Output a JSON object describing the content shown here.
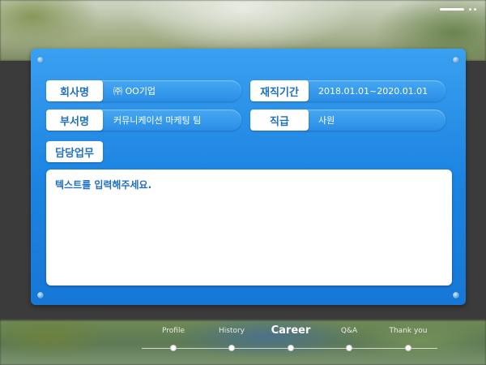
{
  "form": {
    "company_label": "회사명",
    "company_value": "㈜ OO기업",
    "period_label": "재직기간",
    "period_value": "2018.01.01~2020.01.01",
    "department_label": "부서명",
    "department_value": "커뮤니케이션 마케팅 팀",
    "position_label": "직급",
    "position_value": "사원",
    "duties_label": "담당업무",
    "duties_text": "텍스트를 입력해주세요."
  },
  "nav": {
    "items": [
      {
        "label": "Profile"
      },
      {
        "label": "History"
      },
      {
        "label": "Career"
      },
      {
        "label": "Q&A"
      },
      {
        "label": "Thank you"
      }
    ],
    "active": "Career"
  },
  "colors": {
    "panel": "#1c84e2",
    "label_text": "#1f6fc0",
    "value_bar": "#2b8de6",
    "background": "#3b3b3b"
  }
}
